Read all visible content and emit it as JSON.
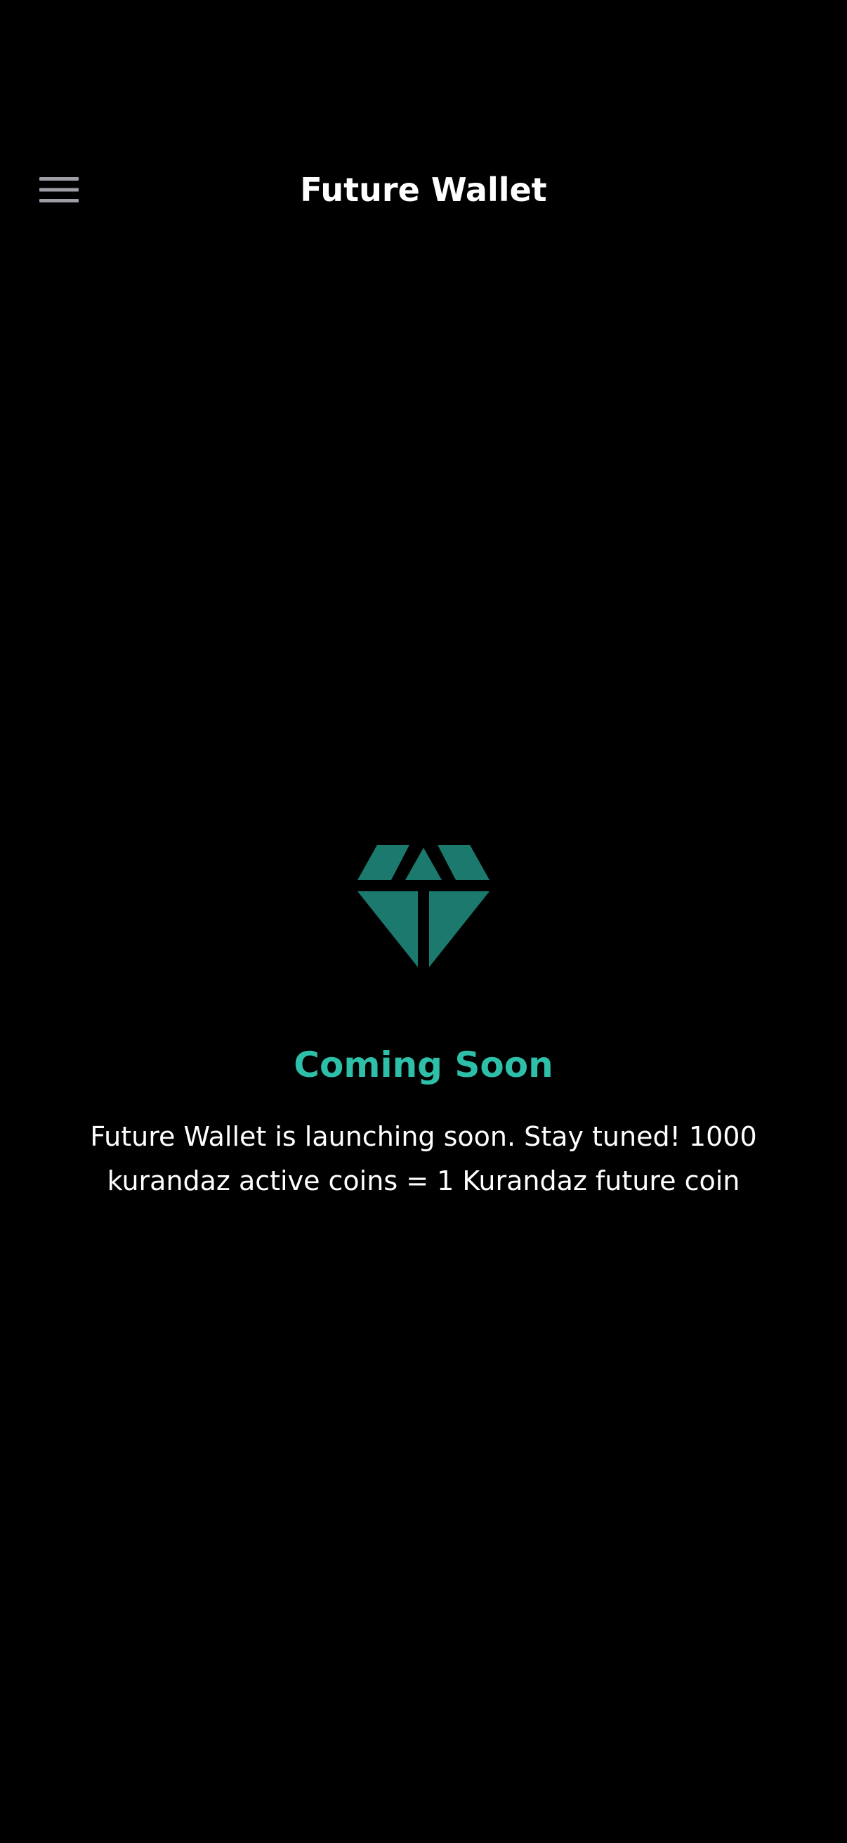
{
  "app_bar": {
    "title": "Future Wallet",
    "menu_icon": "hamburger-menu-icon"
  },
  "main": {
    "icon": "diamond-icon",
    "icon_color": "#1b7a6d",
    "heading": "Coming Soon",
    "heading_color": "#2ebfa8",
    "message": "Future Wallet is launching soon. Stay tuned! 1000 kurandaz active coins = 1 Kurandaz future coin"
  }
}
